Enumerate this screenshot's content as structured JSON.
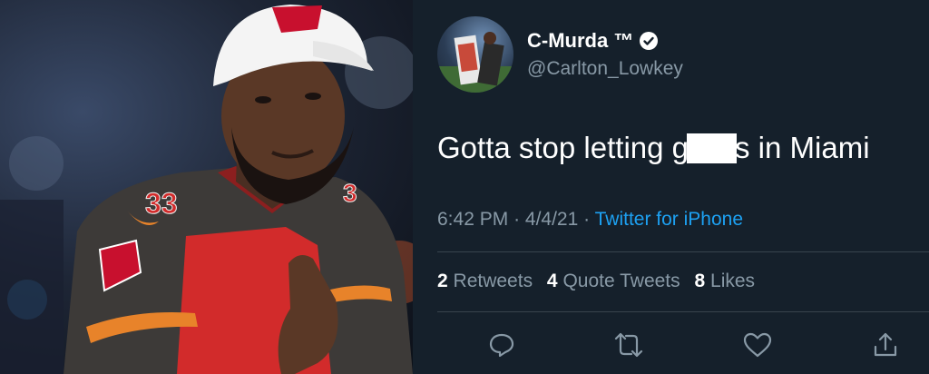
{
  "tweet": {
    "display_name": "C-Murda ™",
    "verified": true,
    "handle": "@Carlton_Lowkey",
    "text_before": "Gotta stop letting g",
    "text_after": "s in Miami",
    "time": "6:42 PM",
    "date": "4/4/21",
    "source": "Twitter for iPhone",
    "separator": "·",
    "retweets_count": "2",
    "retweets_label": "Retweets",
    "quote_count": "4",
    "quote_label": "Quote Tweets",
    "likes_count": "8",
    "likes_label": "Likes"
  },
  "actions": [
    {
      "name": "reply-icon"
    },
    {
      "name": "retweet-icon"
    },
    {
      "name": "like-icon"
    },
    {
      "name": "share-icon"
    }
  ],
  "colors": {
    "background": "#15202b",
    "secondary_text": "#8899a6",
    "link": "#1da1f2",
    "divider": "#38444d",
    "jersey_red": "#d22b2b",
    "jersey_pewter": "#3d3a38"
  }
}
